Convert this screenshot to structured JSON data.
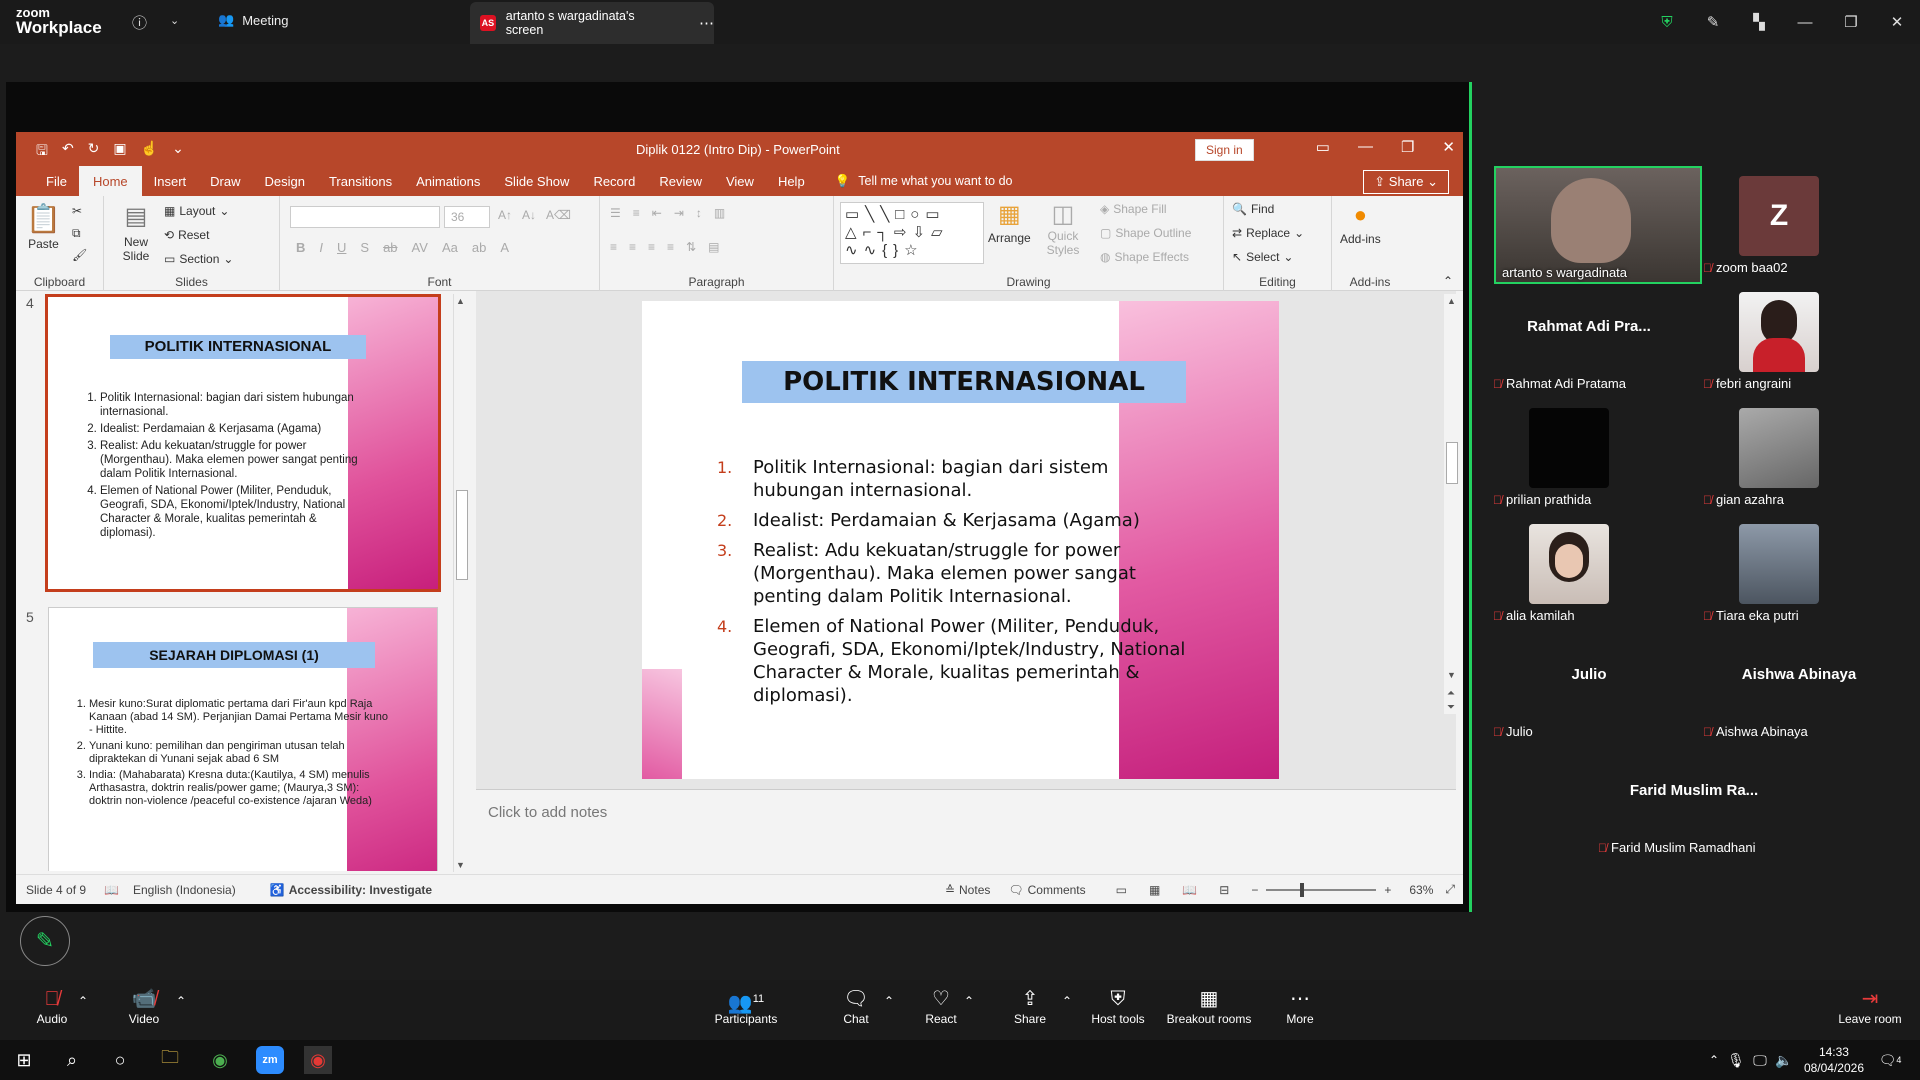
{
  "zoom": {
    "logo_line1": "zoom",
    "logo_line2": "Workplace",
    "meeting_label": "Meeting",
    "screen_tab_initials": "AS",
    "screen_tab_label": "artanto s wargadinata's screen",
    "accent": "#23d160"
  },
  "powerpoint": {
    "title": "Diplik 0122 (Intro Dip)  -  PowerPoint",
    "sign_in": "Sign in",
    "tabs": [
      "File",
      "Home",
      "Insert",
      "Draw",
      "Design",
      "Transitions",
      "Animations",
      "Slide Show",
      "Record",
      "Review",
      "View",
      "Help"
    ],
    "active_tab": "Home",
    "tell_me": "Tell me what you want to do",
    "share": "Share",
    "ribbon": {
      "paste": "Paste",
      "new_slide": "New Slide",
      "layout": "Layout",
      "reset": "Reset",
      "section": "Section",
      "font_size": "36",
      "arrange": "Arrange",
      "quick_styles": "Quick Styles",
      "shape_fill": "Shape Fill",
      "shape_outline": "Shape Outline",
      "shape_effects": "Shape Effects",
      "find": "Find",
      "replace": "Replace",
      "select": "Select",
      "add_ins": "Add-ins",
      "groups": [
        "Clipboard",
        "Slides",
        "Font",
        "Paragraph",
        "Drawing",
        "Editing",
        "Add-ins"
      ]
    },
    "thumb4": {
      "number": "4",
      "title": "POLITIK INTERNASIONAL",
      "items": [
        "Politik Internasional: bagian dari sistem hubungan internasional.",
        "Idealist: Perdamaian & Kerjasama (Agama)",
        "Realist: Adu kekuatan/struggle for power (Morgenthau). Maka elemen power sangat penting dalam Politik Internasional.",
        "Elemen of National Power (Militer, Penduduk, Geografi, SDA, Ekonomi/Iptek/Industry, National Character & Morale, kualitas pemerintah & diplomasi)."
      ]
    },
    "thumb5": {
      "number": "5",
      "title": "SEJARAH DIPLOMASI (1)",
      "items": [
        "Mesir kuno:Surat diplomatic pertama dari Fir'aun kpd Raja Kanaan (abad 14 SM). Perjanjian Damai Pertama Mesir kuno - Hittite.",
        "Yunani kuno: pemilihan dan pengiriman utusan telah dipraktekan di Yunani sejak abad 6 SM",
        "India: (Mahabarata) Kresna duta:(Kautilya, 4 SM) menulis Arthasastra, doktrin realis/power game; (Maurya,3 SM): doktrin non-violence /peaceful co-existence /ajaran Weda)"
      ]
    },
    "slide": {
      "title": "POLITIK INTERNASIONAL",
      "items": [
        {
          "n": "1.",
          "text": "Politik Internasional: bagian dari sistem hubungan internasional."
        },
        {
          "n": "2.",
          "text": "Idealist: Perdamaian & Kerjasama (Agama)"
        },
        {
          "n": "3.",
          "text": "Realist: Adu kekuatan/struggle for power (Morgenthau). Maka elemen power sangat penting dalam Politik Internasional."
        },
        {
          "n": "4.",
          "text": "Elemen of National Power (Militer, Penduduk, Geografi, SDA, Ekonomi/Iptek/Industry, National Character & Morale, kualitas pemerintah & diplomasi)."
        }
      ]
    },
    "notes_placeholder": "Click to add notes",
    "status": {
      "slide_of": "Slide 4 of 9",
      "language": "English (Indonesia)",
      "accessibility": "Accessibility: Investigate",
      "notes": "Notes",
      "comments": "Comments",
      "zoom": "63%"
    }
  },
  "participants": [
    {
      "name": "artanto s wargadinata",
      "self": true
    },
    {
      "name": "zoom baa02",
      "avatar_letter": "Z"
    },
    {
      "name": "Rahmat Adi Pratama",
      "display": "Rahmat Adi Pra..."
    },
    {
      "name": "febri angraini"
    },
    {
      "name": "prilian prathida"
    },
    {
      "name": "gian azahra"
    },
    {
      "name": "alia kamilah"
    },
    {
      "name": "Tiara eka putri"
    },
    {
      "name": "Julio",
      "display": "Julio"
    },
    {
      "name": "Aishwa Abinaya",
      "display": "Aishwa Abinaya"
    },
    {
      "name": "Farid Muslim Ramadhani",
      "display": "Farid Muslim Ra..."
    }
  ],
  "toolbar": {
    "audio": "Audio",
    "video": "Video",
    "participants": "Participants",
    "participants_count": "11",
    "chat": "Chat",
    "react": "React",
    "share": "Share",
    "host_tools": "Host tools",
    "breakout": "Breakout rooms",
    "more": "More",
    "leave": "Leave room"
  },
  "taskbar": {
    "time": "14:33",
    "date": "08/04/2026",
    "notif_count": "4"
  }
}
